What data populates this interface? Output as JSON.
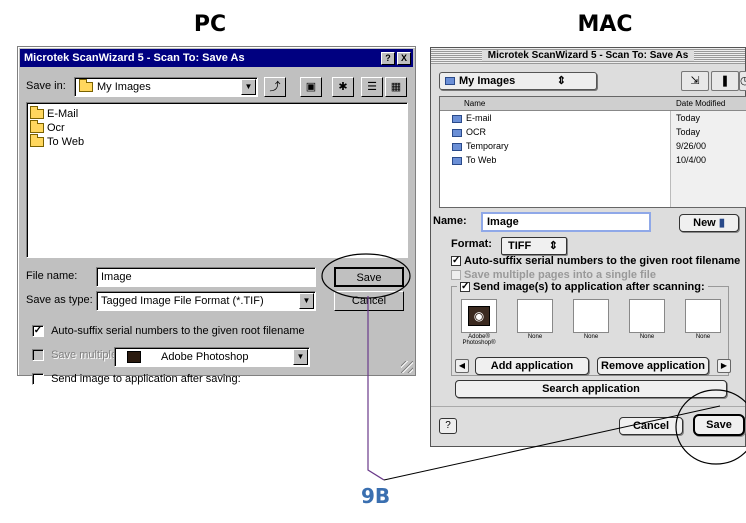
{
  "headings": {
    "pc": "PC",
    "mac": "MAC"
  },
  "callout": "9B",
  "colors": {
    "accent": "#3a6fb0",
    "pc_titlebar": "#000080",
    "mac_field_border": "#8fa8e8"
  },
  "pc": {
    "title": "Microtek ScanWizard 5 - Scan To: Save As",
    "title_buttons": [
      "?",
      "X"
    ],
    "save_in_label": "Save in:",
    "save_in_value": "My Images",
    "toolbar_icons": [
      "up-folder-icon",
      "desktop-icon",
      "new-folder-icon",
      "list-view-icon",
      "details-view-icon"
    ],
    "folders": [
      "E-Mail",
      "Ocr",
      "To Web"
    ],
    "file_name_label": "File name:",
    "file_name_value": "Image",
    "save_as_type_label": "Save as type:",
    "save_as_type_value": "Tagged Image File Format (*.TIF)",
    "save_button": "Save",
    "cancel_button": "Cancel",
    "auto_suffix_label": "Auto-suffix serial numbers to the given root filename",
    "save_multiple_label": "Save multiple images as single file",
    "send_image_label": "Send image to application after saving:",
    "application_value": "Adobe Photoshop"
  },
  "mac": {
    "title": "Microtek ScanWizard 5 - Scan To: Save As",
    "location": "My Images",
    "columns": {
      "name": "Name",
      "date": "Date Modified"
    },
    "files": [
      {
        "name": "E-mail",
        "date": "Today"
      },
      {
        "name": "OCR",
        "date": "Today"
      },
      {
        "name": "Temporary",
        "date": "9/26/00"
      },
      {
        "name": "To Web",
        "date": "10/4/00"
      }
    ],
    "name_label": "Name:",
    "name_value": "Image",
    "new_button": "New",
    "format_label": "Format:",
    "format_value": "TIFF",
    "auto_suffix_label": "Auto-suffix serial numbers to the given root filename",
    "save_multiple_label": "Save multiple pages into a single file",
    "send_image_label": "Send image(s) to application after scanning:",
    "apps": [
      "Adobe® Photoshop®",
      "None",
      "None",
      "None",
      "None"
    ],
    "add_app_button": "Add application",
    "remove_app_button": "Remove application",
    "search_app_button": "Search application",
    "cancel_button": "Cancel",
    "save_button": "Save"
  }
}
